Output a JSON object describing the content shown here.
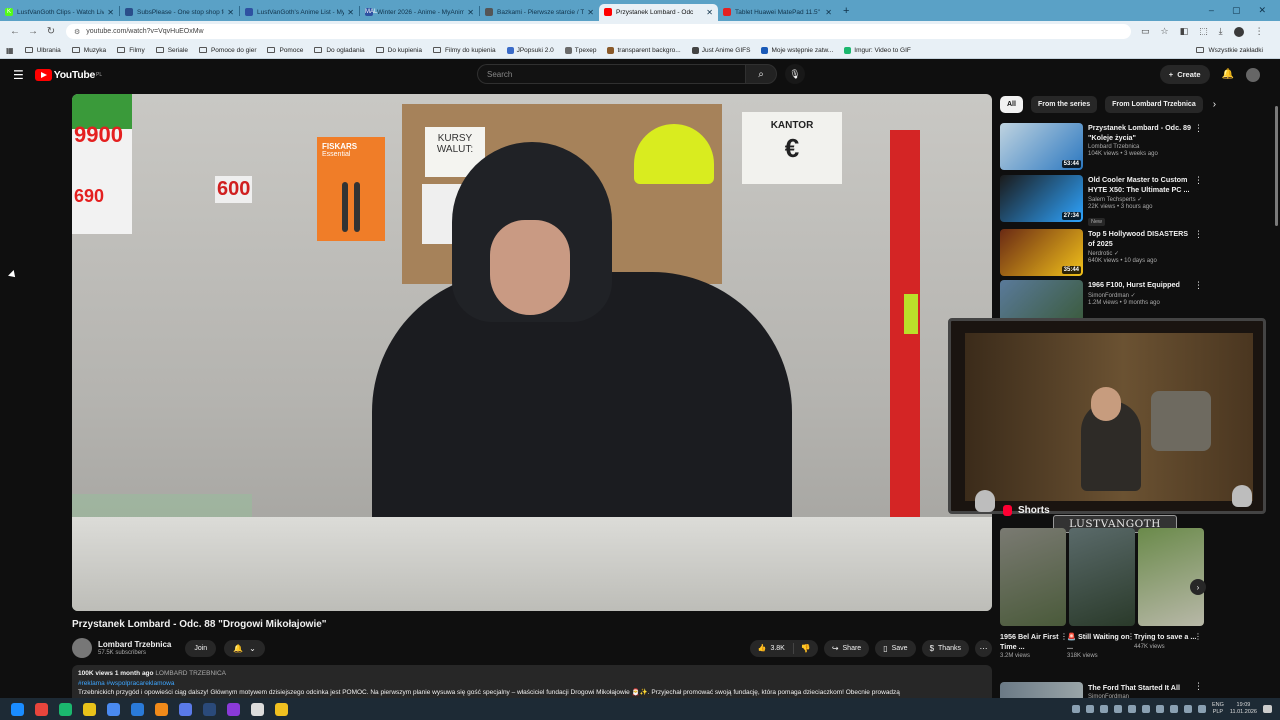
{
  "browser": {
    "tabs": [
      {
        "title": "LustVanGoth Clips - Watch Live",
        "favicon_color": "#53fc18",
        "favicon": "K",
        "active": false
      },
      {
        "title": "SubsPlease - One stop shop fo",
        "favicon_color": "#2a4e8a",
        "favicon": "",
        "active": false
      },
      {
        "title": "LustVanGoth's Anime List - My",
        "favicon_color": "#2e51a2",
        "favicon": "",
        "active": false
      },
      {
        "title": "Winter 2026 - Anime - MyAnim",
        "favicon_color": "#2e51a2",
        "favicon": "MAL",
        "active": false
      },
      {
        "title": "Bazkami - Pierwsze starcie / Th",
        "favicon_color": "#555",
        "favicon": "",
        "active": false
      },
      {
        "title": "Przystanek Lombard - Odc",
        "favicon_color": "#ff0000",
        "favicon": "",
        "active": true
      },
      {
        "title": "Tablet Huawei MatePad 11.5\"",
        "favicon_color": "#e42020",
        "favicon": "",
        "active": false
      }
    ],
    "new_tab": "+",
    "url": "youtube.com/watch?v=VqvHuEOxMw",
    "bookmarks": [
      {
        "label": "Ulbrania",
        "type": "folder"
      },
      {
        "label": "Muzyka",
        "type": "folder"
      },
      {
        "label": "Filmy",
        "type": "folder"
      },
      {
        "label": "Seriale",
        "type": "folder"
      },
      {
        "label": "Pomoce do gier",
        "type": "folder"
      },
      {
        "label": "Pomoce",
        "type": "folder"
      },
      {
        "label": "Do ogladania",
        "type": "folder"
      },
      {
        "label": "Do kupienia",
        "type": "folder"
      },
      {
        "label": "Filmy do kupienia",
        "type": "folder"
      },
      {
        "label": "JPopsuki 2.0",
        "type": "site",
        "color": "#3a6bc8"
      },
      {
        "label": "Tpexep",
        "type": "site",
        "color": "#6a6a6a"
      },
      {
        "label": "transparent backgro...",
        "type": "site",
        "color": "#8a5a2a"
      },
      {
        "label": "Just Anime GIFS",
        "type": "site",
        "color": "#444"
      },
      {
        "label": "Moje wstępnie zatw...",
        "type": "site",
        "color": "#1a5ab8"
      },
      {
        "label": "Imgur: Video to GIF",
        "type": "site",
        "color": "#1bb76e"
      }
    ],
    "bookmarks_right": "Wszystkie zakładki"
  },
  "youtube": {
    "logo_text": "YouTube",
    "logo_region": "PL",
    "search_placeholder": "Search",
    "create_label": "Create",
    "video": {
      "title": "Przystanek Lombard - Odc. 88 \"Drogowi Mikołajowie\"",
      "channel": "Lombard Trzebnica",
      "subscribers": "57.5K subscribers",
      "join": "Join",
      "likes": "3.8K",
      "share": "Share",
      "save": "Save",
      "thanks": "Thanks",
      "views_date": "100K views  1 month ago",
      "channel_tag": "LOMBARD TRZEBNICA",
      "hashtags": "#reklama #wspolpracareklamowa",
      "description": "Trzebnickich przygód i opowieści ciąg dalszy! Głównym motywem dzisiejszego odcinka jest POMOC. Na pierwszym planie wysuwa się gość specjalny – właściciel fundacji Drogowi Mikołajowie 🎅✨. Przyjechał promować swoją fundację, która pomaga dzieciaczkom! Obecnie prowadzą"
    },
    "player_scene": {
      "prices": [
        "9900",
        "99",
        "690",
        "600",
        "690"
      ],
      "sign_text": "KURSY WALUT:",
      "fiskars": "FISKARS",
      "fiskars_sub": "Essential",
      "kantor": "KANTOR",
      "kantor_symbol": "€"
    },
    "overlay_name": "LUSTVANGOTH",
    "chips": [
      {
        "label": "All",
        "selected": true
      },
      {
        "label": "From the series",
        "selected": false
      },
      {
        "label": "From Lombard Trzebnica",
        "selected": false
      }
    ],
    "recommendations": [
      {
        "title": "Przystanek Lombard - Odc. 89 \"Koleje życia\"",
        "channel": "Lombard Trzebnica",
        "meta": "104K views • 3 weeks ago",
        "duration": "53:44",
        "badge": "",
        "verified": false,
        "colors": [
          "#bfd3e0",
          "#2c78c0"
        ]
      },
      {
        "title": "Old Cooler Master to Custom HYTE X50: The Ultimate PC ...",
        "channel": "Salem Techsperts",
        "meta": "22K views • 3 hours ago",
        "duration": "27:34",
        "badge": "New",
        "verified": true,
        "colors": [
          "#1a1a1a",
          "#2ea4ff"
        ]
      },
      {
        "title": "Top 5 Hollywood DISASTERS of 2025",
        "channel": "Nerdrotic",
        "meta": "640K views • 10 days ago",
        "duration": "35:44",
        "badge": "",
        "verified": true,
        "colors": [
          "#6a2a14",
          "#f2c21a"
        ]
      },
      {
        "title": "1966 F100, Hurst Equipped",
        "channel": "SimonFordman",
        "meta": "1.2M views • 9 months ago",
        "duration": "",
        "badge": "",
        "verified": true,
        "colors": [
          "#5a7a9a",
          "#3a5a3a"
        ]
      }
    ],
    "shorts_title": "Shorts",
    "shorts": [
      {
        "title": "1956 Bel Air First Time ...",
        "meta": "3.2M views",
        "colors": [
          "#7a7a72",
          "#4a5a3a"
        ]
      },
      {
        "title": "🚨 Still Waiting on ...",
        "meta": "318K views",
        "colors": [
          "#5a6a6a",
          "#2a3a2a"
        ]
      },
      {
        "title": "Trying to save a ...",
        "meta": "447K views",
        "colors": [
          "#6a8a4a",
          "#b8b8a8"
        ]
      }
    ],
    "last_rec": {
      "title": "The Ford That Started It All",
      "channel": "SimonFordman"
    }
  },
  "taskbar": {
    "apps": [
      {
        "name": "windows-start-icon",
        "color": "#1a8cff"
      },
      {
        "name": "chrome-icon",
        "color": "#e8453c"
      },
      {
        "name": "terminal-icon",
        "color": "#1bb76e"
      },
      {
        "name": "app-icon",
        "color": "#e8c21a"
      },
      {
        "name": "chrome-active-icon",
        "color": "#4a8af0"
      },
      {
        "name": "store-icon",
        "color": "#2a7ad8"
      },
      {
        "name": "vlc-icon",
        "color": "#f08a1a"
      },
      {
        "name": "browser-icon",
        "color": "#5a7ae8"
      },
      {
        "name": "steam-icon",
        "color": "#2a4a7a"
      },
      {
        "name": "obs-icon",
        "color": "#8a3ad8"
      },
      {
        "name": "discord-icon",
        "color": "#dcdcdc"
      },
      {
        "name": "explorer-icon",
        "color": "#f0c020"
      }
    ],
    "lang": "ENG",
    "lang2": "PLP",
    "time": "19:09",
    "date": "11.01.2026"
  }
}
